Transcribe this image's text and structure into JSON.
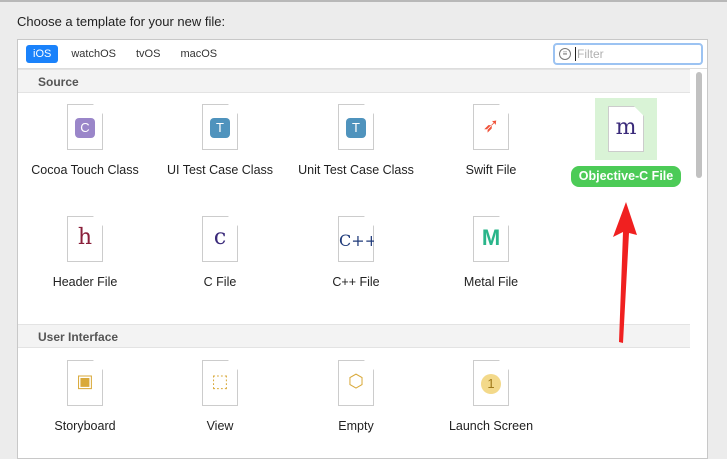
{
  "prompt": "Choose a template for your new file:",
  "tabs": [
    "iOS",
    "watchOS",
    "tvOS",
    "macOS"
  ],
  "filter": {
    "placeholder": "Filter"
  },
  "sections": [
    {
      "title": "Source",
      "items": [
        {
          "label": "Cocoa Touch Class",
          "glyph": "C"
        },
        {
          "label": "UI Test Case Class",
          "glyph": "T"
        },
        {
          "label": "Unit Test Case Class",
          "glyph": "T"
        },
        {
          "label": "Swift File",
          "glyph": "swift"
        },
        {
          "label": "Objective-C File",
          "glyph": "m"
        },
        {
          "label": "Header File",
          "glyph": "h"
        },
        {
          "label": "C File",
          "glyph": "c"
        },
        {
          "label": "C++ File",
          "glyph": "C++"
        },
        {
          "label": "Metal File",
          "glyph": "M"
        }
      ]
    },
    {
      "title": "User Interface",
      "items": [
        {
          "label": "Storyboard"
        },
        {
          "label": "View"
        },
        {
          "label": "Empty"
        },
        {
          "label": "Launch Screen",
          "glyph": "1"
        }
      ]
    }
  ],
  "colors": {
    "accent": "#1a82fb",
    "selected": "#4ccb57",
    "arrow": "#f02020"
  }
}
